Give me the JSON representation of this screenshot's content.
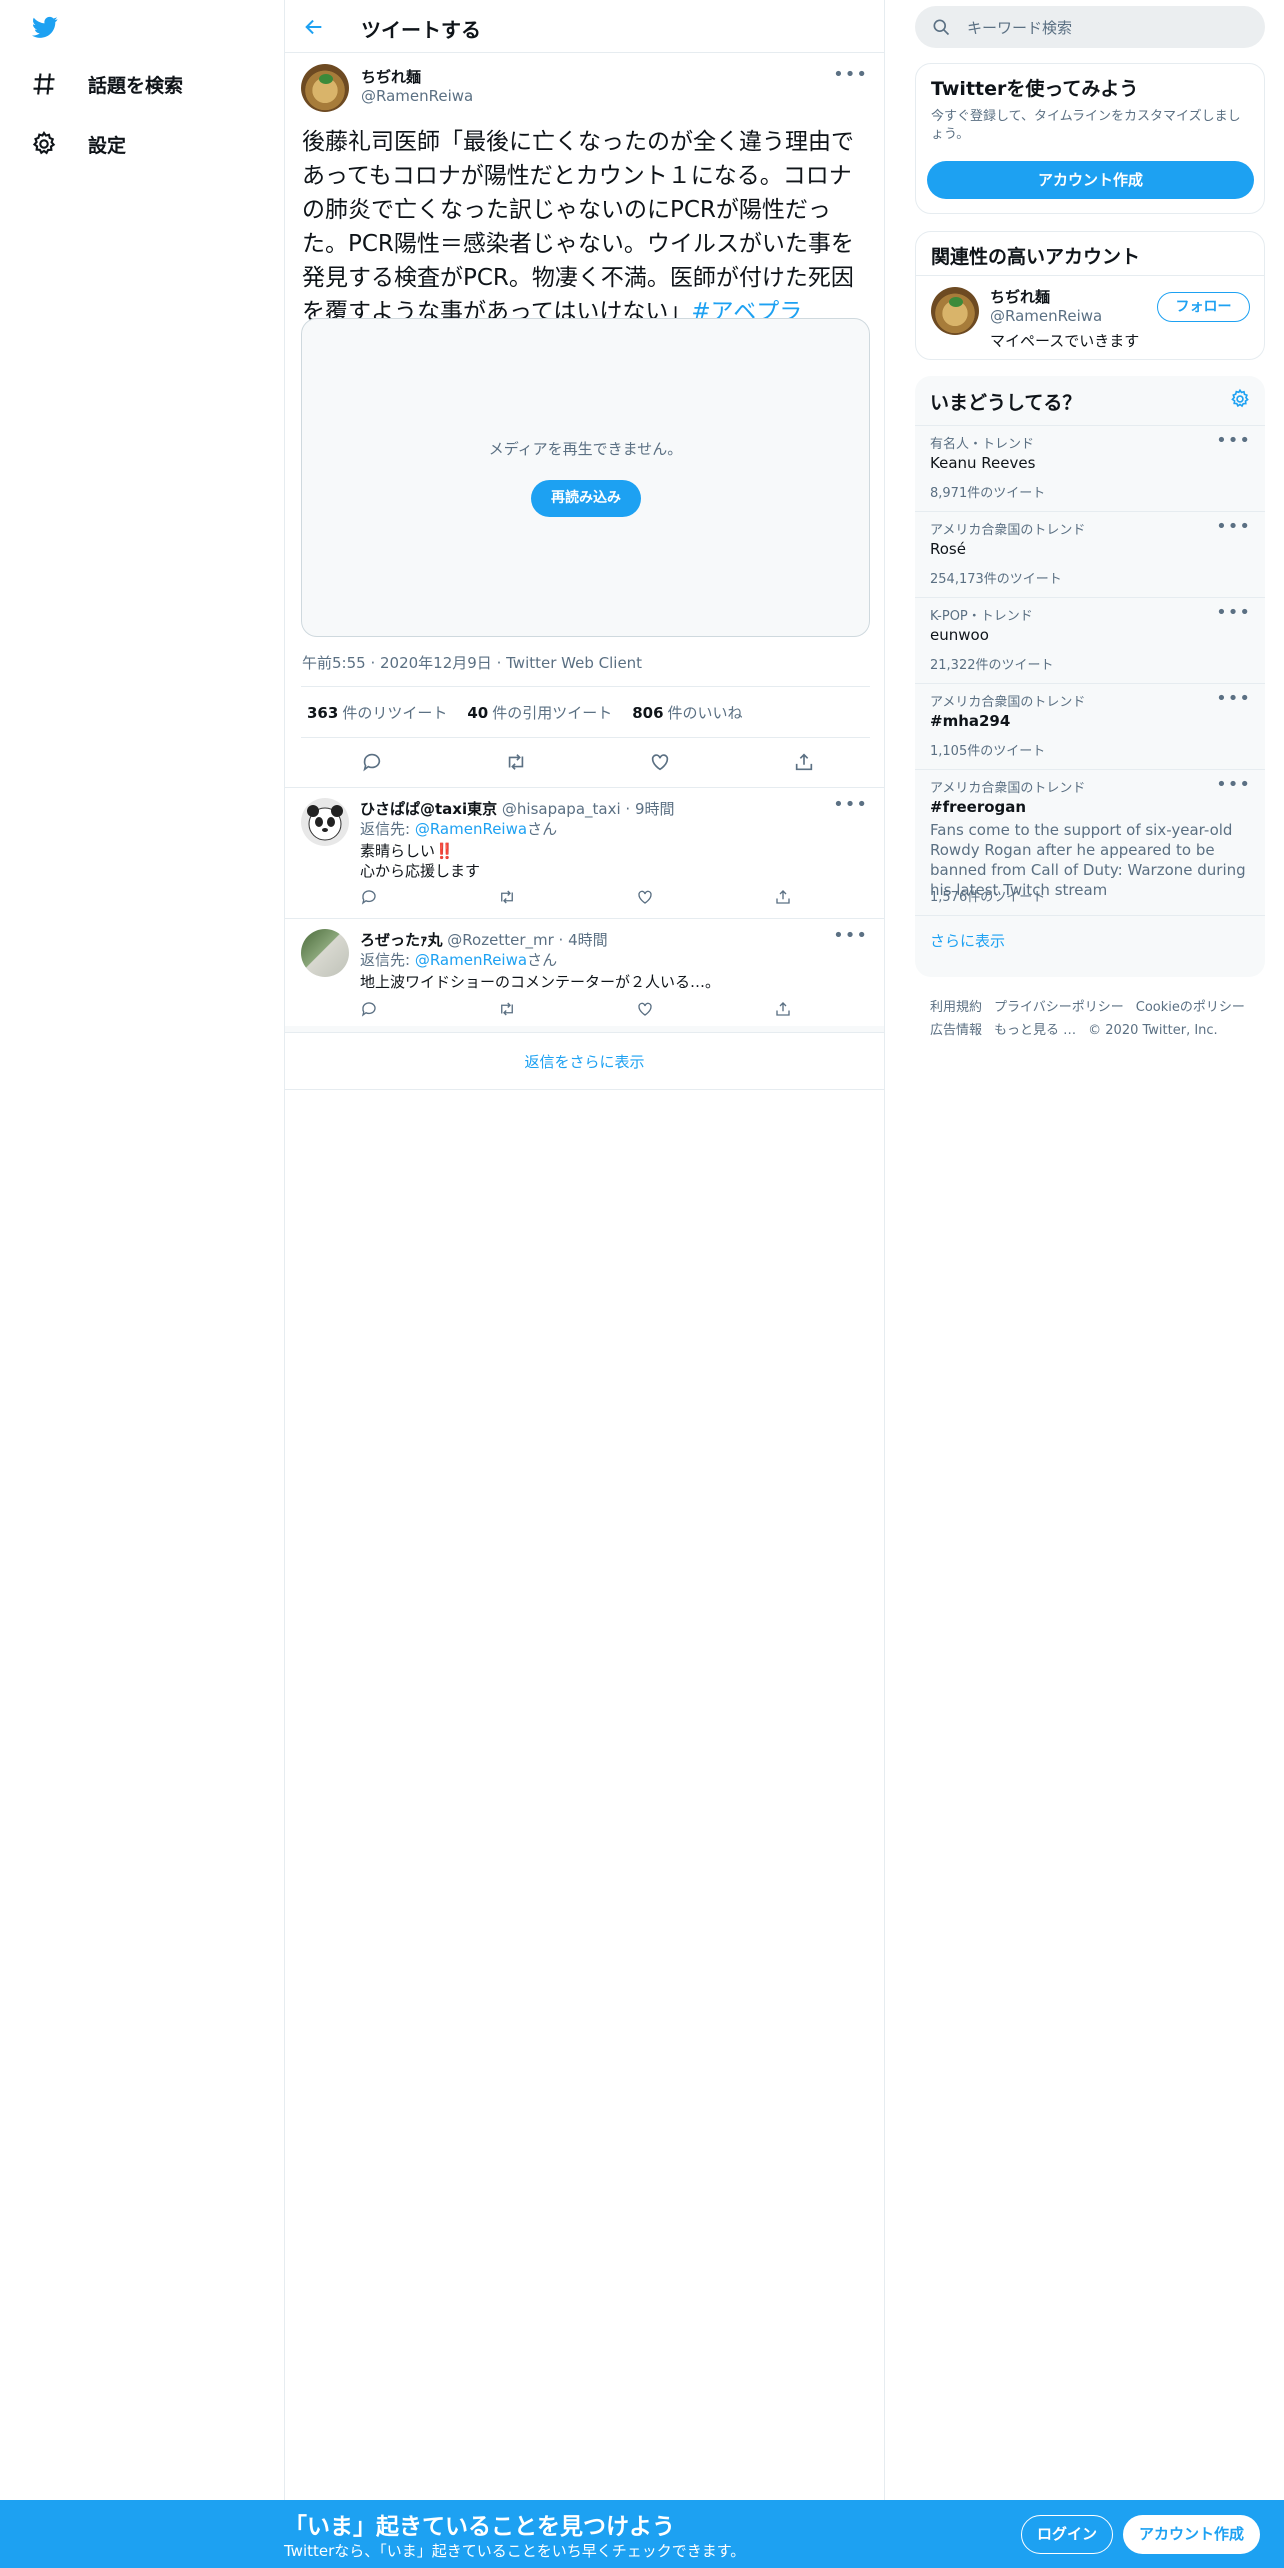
{
  "nav": {
    "items": [
      {
        "label": "話題を検索",
        "icon": "hashtag-icon"
      },
      {
        "label": "設定",
        "icon": "gear-icon"
      }
    ]
  },
  "header": {
    "title": "ツイートする"
  },
  "tweet": {
    "name": "ちぢれ麺",
    "handle": "@RamenReiwa",
    "text": "後藤礼司医師「最後に亡くなったのが全く違う理由であってもコロナが陽性だとカウント１になる。コロナの肺炎で亡くなった訳じゃないのにPCRが陽性だった。PCR陽性＝感染者じゃない。ウイルスがいた事を発見する検査がPCR。物凄く不満。医師が付けた死因を覆すような事があってはいけない」",
    "hashtag": "#アベプラ",
    "media_message": "メディアを再生できません。",
    "reload_label": "再読み込み",
    "time": "午前5:55",
    "date": "2020年12月9日",
    "client": "Twitter Web Client",
    "retweets": {
      "count": "363",
      "label": "件のリツイート"
    },
    "quotes": {
      "count": "40",
      "label": "件の引用ツイート"
    },
    "likes": {
      "count": "806",
      "label": "件のいいね"
    }
  },
  "replies": [
    {
      "name": "ひさぱぱ@taxi東京",
      "handle": "@hisapapa_taxi",
      "time": "9時間",
      "reply_to_prefix": "返信先: ",
      "reply_to": "@RamenReiwa",
      "reply_to_suffix": "さん",
      "line1": "素晴らしい",
      "emoji": "‼️",
      "line2": "心から応援します"
    },
    {
      "name": "ろぜったｧ丸",
      "handle": "@Rozetter_mr",
      "time": "4時間",
      "reply_to_prefix": "返信先: ",
      "reply_to": "@RamenReiwa",
      "reply_to_suffix": "さん",
      "line1": "地上波ワイドショーのコメンテーターが２人いる…。"
    }
  ],
  "more_replies": "返信をさらに表示",
  "sidebar": {
    "search_placeholder": "キーワード検索",
    "signup": {
      "title": "Twitterを使ってみよう",
      "desc": "今すぐ登録して、タイムラインをカスタマイズしましょう。",
      "button": "アカウント作成"
    },
    "related": {
      "title": "関連性の高いアカウント",
      "name": "ちぢれ麺",
      "handle": "@RamenReiwa",
      "bio": "マイペースでいきます",
      "follow": "フォロー"
    },
    "trends": {
      "title": "いまどうしてる？",
      "items": [
        {
          "context": "有名人・トレンド",
          "name": "Keanu Reeves",
          "count": "8,971件のツイート"
        },
        {
          "context": "アメリカ合衆国のトレンド",
          "name": "Rosé",
          "count": "254,173件のツイート"
        },
        {
          "context": "K-POP・トレンド",
          "name": "eunwoo",
          "count": "21,322件のツイート"
        },
        {
          "context": "アメリカ合衆国のトレンド",
          "name": "#mha294",
          "count": "1,105件のツイート"
        },
        {
          "context": "アメリカ合衆国のトレンド",
          "name": "#freerogan",
          "desc": "Fans come to the support of six-year-old Rowdy Rogan after he appeared to be banned from Call of Duty: Warzone during his latest Twitch stream",
          "count": "1,576件のツイート"
        }
      ],
      "show_more": "さらに表示"
    },
    "footer": [
      "利用規約",
      "プライバシーポリシー",
      "Cookieのポリシー",
      "広告情報",
      "もっと見る …",
      "© 2020 Twitter, Inc."
    ]
  },
  "banner": {
    "headline": "「いま」起きていることを見つけよう",
    "sub": "Twitterなら、「いま」起きていることをいち早くチェックできます。",
    "login": "ログイン",
    "signup": "アカウント作成"
  },
  "colors": {
    "accent": "#1da1f2",
    "muted": "#5b7083",
    "border": "#e6ecf0"
  }
}
